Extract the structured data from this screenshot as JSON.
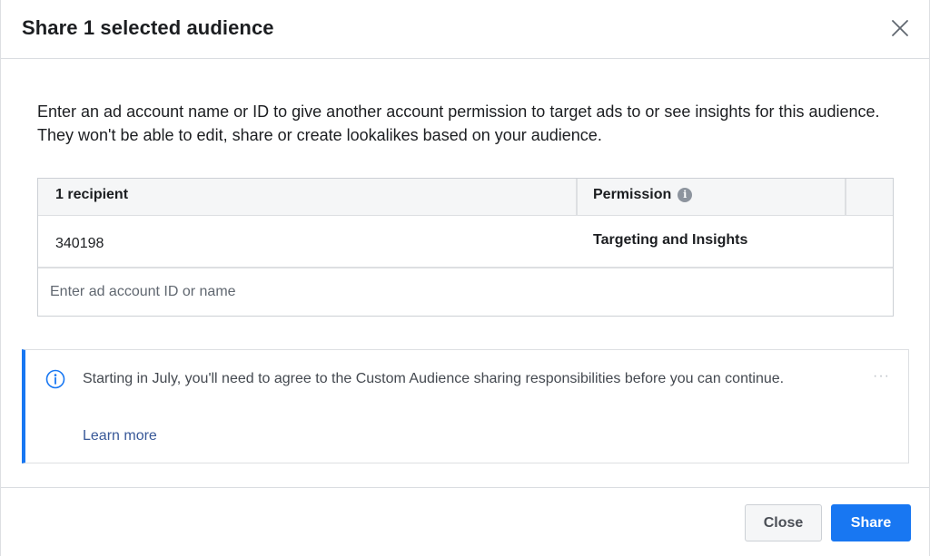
{
  "dialog": {
    "title": "Share 1 selected audience"
  },
  "body": {
    "description": "Enter an ad account name or ID to give another account permission to target ads to or see insights for this audience. They won't be able to edit, share or create lookalikes based on your audience."
  },
  "recipients_table": {
    "columns": {
      "recipient": "1 recipient",
      "permission": "Permission"
    },
    "rows": [
      {
        "id": "340198",
        "permission": "Targeting and Insights"
      }
    ],
    "input_placeholder": "Enter ad account ID or name",
    "input_value": ""
  },
  "notice": {
    "text": "Starting in July, you'll need to agree to the Custom Audience sharing responsibilities before you can continue.",
    "link_label": "Learn more",
    "more_label": "···"
  },
  "footer": {
    "close_label": "Close",
    "share_label": "Share"
  },
  "colors": {
    "accent": "#1877f2",
    "link": "#385898",
    "border": "#dddfe2"
  },
  "icons": {
    "close": "close-icon",
    "permission_info": "info-icon",
    "notice": "info-circle-icon",
    "more": "more-icon"
  }
}
